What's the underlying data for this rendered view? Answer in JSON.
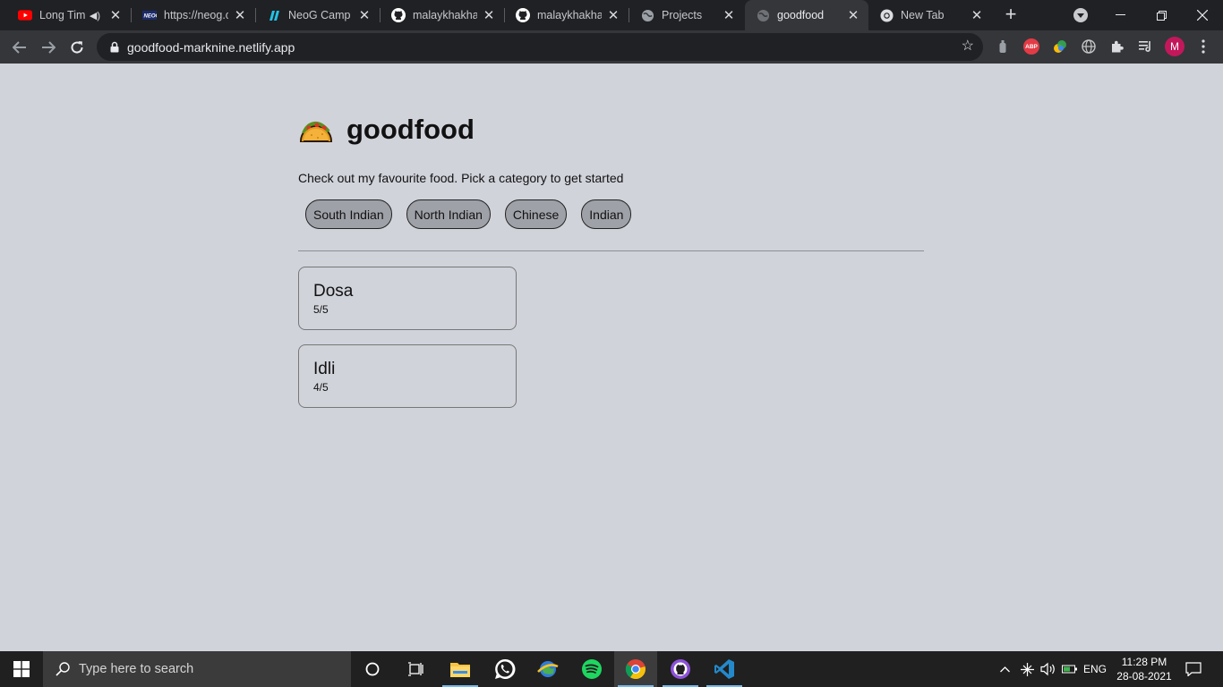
{
  "browser": {
    "tabs": [
      {
        "title": "Long Tim",
        "icon": "youtube-icon",
        "audio": true
      },
      {
        "title": "https://neog.c",
        "icon": "neog-icon"
      },
      {
        "title": "NeoG Camp A",
        "icon": "neogcamp-icon"
      },
      {
        "title": "malaykhakhar",
        "icon": "github-icon"
      },
      {
        "title": "malaykhakhar",
        "icon": "github-icon"
      },
      {
        "title": "Projects",
        "icon": "globe-icon"
      },
      {
        "title": "goodfood",
        "icon": "globe-icon",
        "active": true
      },
      {
        "title": "New Tab",
        "icon": "chrome-icon"
      }
    ],
    "url": "goodfood-marknine.netlify.app",
    "profile_initial": "M",
    "abp_label": "ABP"
  },
  "page": {
    "emoji": "taco-icon",
    "title": "goodfood",
    "subtitle": "Check out my favourite food. Pick a category to get started",
    "categories": [
      "South Indian",
      "North Indian",
      "Chinese",
      "Indian"
    ],
    "foods": [
      {
        "name": "Dosa",
        "rating": "5/5"
      },
      {
        "name": "Idli",
        "rating": "4/5"
      }
    ]
  },
  "taskbar": {
    "search_placeholder": "Type here to search",
    "language": "ENG",
    "time": "11:28 PM",
    "date": "28-08-2021"
  },
  "colors": {
    "page_bg": "#d1d3db",
    "button_bg": "#9fa1a8",
    "tabstrip_bg": "#202124",
    "toolbar_bg": "#35363a",
    "taskbar_bg": "#202020"
  }
}
